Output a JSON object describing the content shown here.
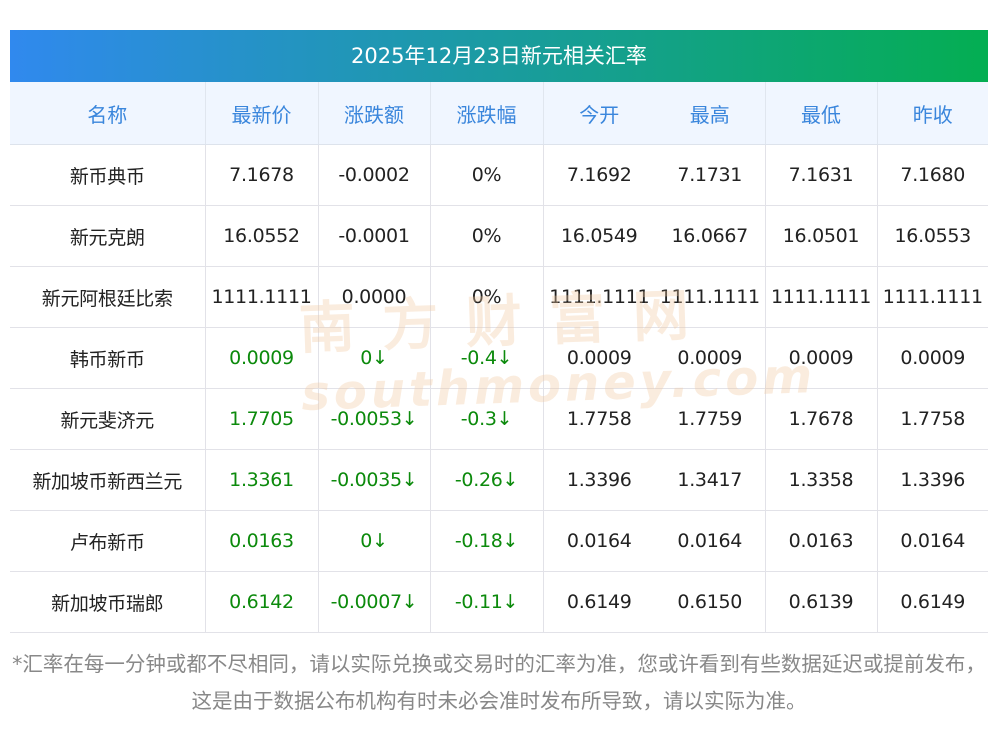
{
  "title": "2025年12月23日新元相关汇率",
  "headers": [
    "名称",
    "最新价",
    "涨跌额",
    "涨跌幅",
    "今开",
    "最高",
    "最低",
    "昨收"
  ],
  "rows": [
    [
      "新币典币",
      "7.1678",
      "-0.0002",
      "0%",
      "7.1692",
      "7.1731",
      "7.1631",
      "7.1680"
    ],
    [
      "新元克朗",
      "16.0552",
      "-0.0001",
      "0%",
      "16.0549",
      "16.0667",
      "16.0501",
      "16.0553"
    ],
    [
      "新元阿根廷比索",
      "1111.1111",
      "0.0000",
      "0%",
      "1111.1111",
      "1111.1111",
      "1111.1111",
      "1111.1111"
    ],
    [
      "韩币新币",
      "0.0009",
      "0↓",
      "-0.4↓",
      "0.0009",
      "0.0009",
      "0.0009",
      "0.0009"
    ],
    [
      "新元斐济元",
      "1.7705",
      "-0.0053↓",
      "-0.3↓",
      "1.7758",
      "1.7759",
      "1.7678",
      "1.7758"
    ],
    [
      "新加坡币新西兰元",
      "1.3361",
      "-0.0035↓",
      "-0.26↓",
      "1.3396",
      "1.3417",
      "1.3358",
      "1.3396"
    ],
    [
      "卢布新币",
      "0.0163",
      "0↓",
      "-0.18↓",
      "0.0164",
      "0.0164",
      "0.0163",
      "0.0164"
    ],
    [
      "新加坡币瑞郎",
      "0.6142",
      "-0.0007↓",
      "-0.11↓",
      "0.6149",
      "0.6150",
      "0.6139",
      "0.6149"
    ]
  ],
  "green_rows": [
    3,
    4,
    5,
    6,
    7
  ],
  "watermark": {
    "cn": "南方财富网",
    "en": "southmoney.com"
  },
  "note": "*汇率在每一分钟或都不尽相同，请以实际兑换或交易时的汇率为准，您或许看到有些数据延迟或提前发布，这是由于数据公布机构有时未必会准时发布所导致，请以实际为准。",
  "colors": {
    "header_text": "#3a86dc",
    "down": "#0c8a0c"
  }
}
